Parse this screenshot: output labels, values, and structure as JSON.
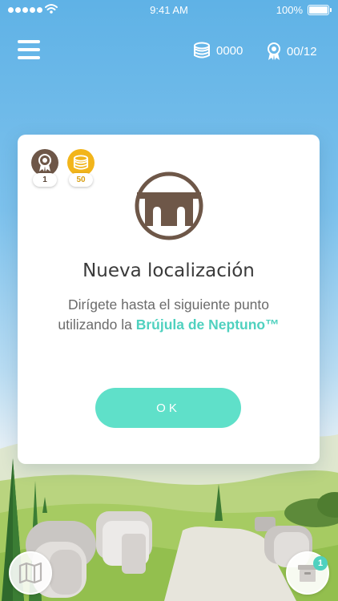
{
  "status_bar": {
    "time": "9:41 AM",
    "battery": "100%",
    "signal_bars": 5,
    "wifi_icon": "wifi-icon",
    "battery_icon": "battery-icon"
  },
  "header": {
    "menu_icon": "hamburger-menu-icon",
    "coins": {
      "icon": "coin-stack-icon",
      "value": "0000"
    },
    "awards": {
      "icon": "award-ribbon-icon",
      "value": "00/12"
    }
  },
  "dialog": {
    "badges": [
      {
        "icon": "award-ribbon-icon",
        "value": "1"
      },
      {
        "icon": "coin-stack-icon",
        "value": "50"
      }
    ],
    "icon": "aqueduct-bridge-icon",
    "title": "Nueva localización",
    "message_line1": "Dirígete hasta el siguiente punto",
    "message_line2_prefix": "utilizando la ",
    "message_highlight": "Brújula de Neptuno™",
    "ok_label": "OK"
  },
  "bottom_bar": {
    "map_icon": "folded-map-icon",
    "box_icon": "archive-box-icon",
    "box_count": "1"
  },
  "colors": {
    "sky_top": "#5fb2e6",
    "accent_teal": "#5fe0c9",
    "highlight_teal": "#4fd1bf",
    "brand_brown": "#6e5748",
    "coin_gold": "#f2b51b"
  }
}
